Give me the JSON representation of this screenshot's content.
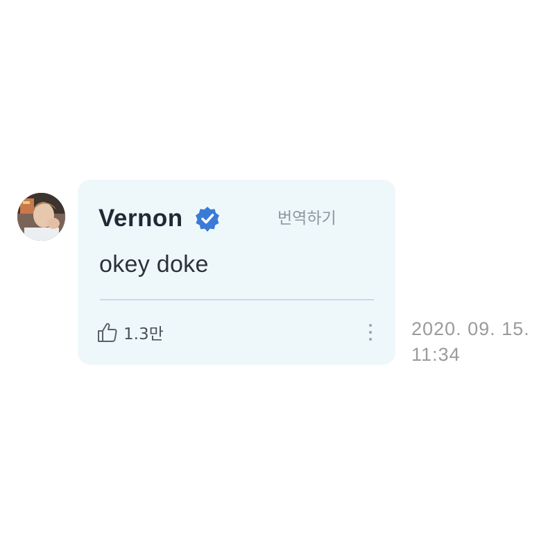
{
  "comment": {
    "author": "Vernon",
    "verified_icon": "verified-badge-icon",
    "translate_label": "번역하기",
    "message": "okey doke",
    "like_icon": "thumbs-up-icon",
    "like_count": "1.3만",
    "more_icon": "more-vertical-icon",
    "date": "2020. 09. 15.",
    "time": "11:34"
  },
  "colors": {
    "bubble_background": "#eef8fb",
    "verified_badge": "#3a7bd5",
    "author_text": "#1f2a36",
    "muted_text": "#9a9a9a"
  }
}
